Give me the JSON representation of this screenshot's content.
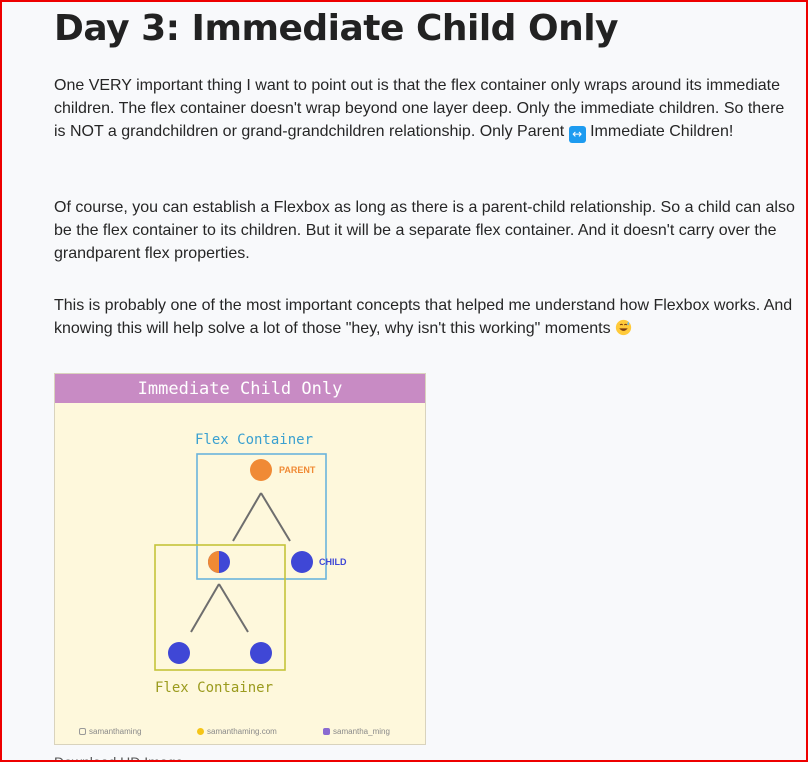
{
  "article": {
    "heading": "Day 3: Immediate Child Only",
    "para1_text": "One VERY important thing I want to point out is that the flex container only wraps around its immediate children. The flex container doesn't wrap beyond one layer deep. Only the immediate children. So there is NOT a grandchildren or grand-grandchildren relationship. Only Parent",
    "para1_emoji": "↔",
    "para1_tail": "Immediate Children!",
    "para2": "Of course, you can establish a Flexbox as long as there is a parent-child relationship. So a child can also be the flex container to its children. But it will be a separate flex container. And it doesn't carry over the grandparent flex properties.",
    "para3_text": "This is probably one of the most important concepts that helped me understand how Flexbox works. And knowing this will help solve a lot of those \"hey, why isn't this working\" moments",
    "para3_emoji": "grinning-sweat-emoji"
  },
  "figure": {
    "title": "Immediate Child Only",
    "top_container_label": "Flex Container",
    "bottom_container_label": "Flex Container",
    "parent_label": "PARENT",
    "child_label": "CHILD",
    "credits": {
      "instagram": "samanthaming",
      "website": "samanthaming.com",
      "twitter": "samantha_ming"
    },
    "colors": {
      "title_bar": "#c88bc4",
      "background": "#fef8dc",
      "top_container": "#6ab4dc",
      "bottom_container": "#c4c43a",
      "parent_dot": "#f08a35",
      "child_dot": "#3f47d6",
      "branch": "#6e6e6e"
    }
  },
  "caption": "Download HD Image"
}
